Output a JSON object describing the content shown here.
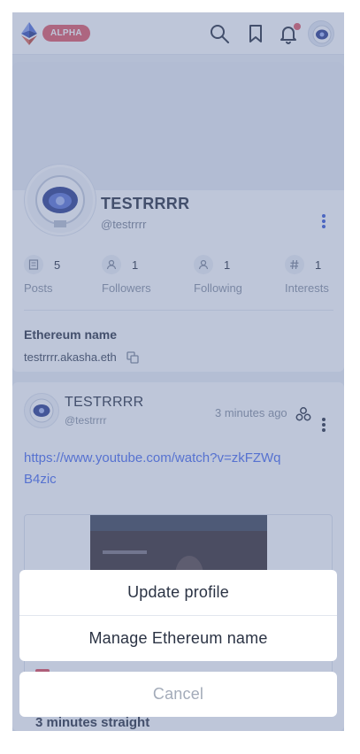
{
  "header": {
    "badge": "ALPHA",
    "icons": [
      "ethereum-logo",
      "search-icon",
      "bookmark-icon",
      "bell-icon",
      "avatar"
    ]
  },
  "profile": {
    "name": "TESTRRRR",
    "handle": "@testrrrr",
    "stats": [
      {
        "icon": "posts-icon",
        "count": "5",
        "label": "Posts"
      },
      {
        "icon": "followers-icon",
        "count": "1",
        "label": "Followers"
      },
      {
        "icon": "following-icon",
        "count": "1",
        "label": "Following"
      },
      {
        "icon": "hash-icon",
        "count": "1",
        "label": "Interests"
      }
    ],
    "ens_title": "Ethereum name",
    "ens_value": "testrrrr.akasha.eth"
  },
  "post": {
    "author": "TESTRRRR",
    "handle": "@testrrrr",
    "time": "3 minutes ago",
    "link": "https://www.youtube.com/watch?v=zkFZWqB4zic",
    "embed_caption": "3 minutes straight"
  },
  "action_sheet": {
    "items": [
      "Update profile",
      "Manage Ethereum name"
    ],
    "cancel": "Cancel"
  },
  "colors": {
    "accent": "#4d6ef0",
    "badge": "#e25a66",
    "text": "#2b3344",
    "muted": "#8a93a3"
  }
}
